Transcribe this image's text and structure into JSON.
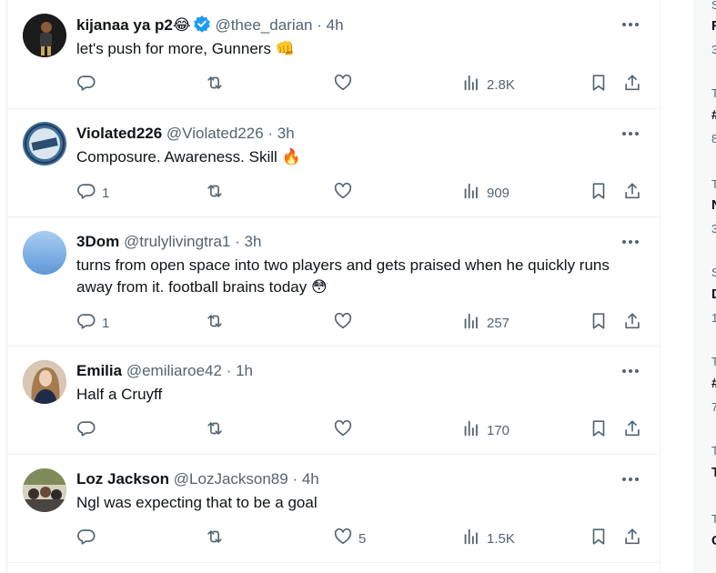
{
  "tweets": [
    {
      "name": "kijanaa ya p2😂",
      "verified": true,
      "handle": "@thee_darian",
      "time": "· 4h",
      "text": "let's push for more, Gunners 👊",
      "replies": "",
      "likes": "",
      "views": "2.8K",
      "avatar_color": "#2a2a2a"
    },
    {
      "name": "Violated226",
      "verified": false,
      "handle": "@Violated226",
      "time": "· 3h",
      "text": "Composure. Awareness. Skill 🔥",
      "replies": "1",
      "likes": "",
      "views": "909",
      "avatar_color": "#5b7fa6"
    },
    {
      "name": "3Dom",
      "verified": false,
      "handle": "@trulylivingtra1",
      "time": "· 3h",
      "text": "turns from open space into two players and gets praised when he quickly runs away from it. football brains today 😳",
      "replies": "1",
      "likes": "",
      "views": "257",
      "avatar_color": "#7fb0e6"
    },
    {
      "name": "Emilia",
      "verified": false,
      "handle": "@emiliaroe42",
      "time": "· 1h",
      "text": "Half a Cruyff",
      "replies": "",
      "likes": "",
      "views": "170",
      "avatar_color": "#c49a7a"
    },
    {
      "name": "Loz Jackson",
      "verified": false,
      "handle": "@LozJackson89",
      "time": "· 4h",
      "text": "Ngl was expecting that to be a goal",
      "replies": "",
      "likes": "5",
      "views": "1.5K",
      "avatar_color": "#8a8f6a"
    }
  ],
  "right_rail": {
    "lines": [
      "S",
      "F",
      "3",
      "T",
      "#",
      "8",
      "T",
      "N",
      "3",
      "S",
      "D",
      "1",
      "T",
      "#",
      "7",
      "T",
      "T",
      "T",
      "C"
    ]
  },
  "colors": {
    "accent": "#1d9bf0",
    "secondary_text": "#536471",
    "divider": "#eff3f4"
  }
}
